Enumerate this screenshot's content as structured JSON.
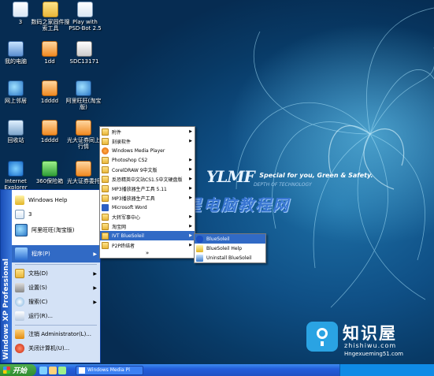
{
  "desktop_icons": [
    {
      "label": "3",
      "icon": "document-icon"
    },
    {
      "label": "数码之家固件搜索工具",
      "icon": "folder-icon"
    },
    {
      "label": "Play with PSD-Bot 2.5",
      "icon": "document-icon"
    },
    {
      "label": "我的电脑",
      "icon": "computer-icon"
    },
    {
      "label": "1dd",
      "icon": "app-icon"
    },
    {
      "label": "SDC13171",
      "icon": "video-icon"
    },
    {
      "label": "网上邻居",
      "icon": "network-icon"
    },
    {
      "label": "1dddd",
      "icon": "app-icon"
    },
    {
      "label": "阿里旺旺(淘宝版)",
      "icon": "network-icon"
    },
    {
      "label": "回收站",
      "icon": "recycle-bin-icon"
    },
    {
      "label": "1dddd",
      "icon": "app-icon"
    },
    {
      "label": "光大证券同上行情",
      "icon": "app-icon"
    },
    {
      "label": "Internet Explorer",
      "icon": "ie-icon"
    },
    {
      "label": "360保险箱",
      "icon": "safe-icon"
    },
    {
      "label": "光大证券委托",
      "icon": "app-icon"
    }
  ],
  "wallpaper": {
    "brand": "YLMF",
    "tagline": "Special for you, Green & Safety.",
    "subtitle": "DEPTH OF TECHNOLOGY"
  },
  "watermark": "星星电脑教程网",
  "start_menu": {
    "band_text": "Windows XP Professional",
    "pinned": [
      {
        "label": "Windows Help"
      },
      {
        "label": "3"
      },
      {
        "label": "阿里旺旺(淘宝版)"
      }
    ],
    "items": [
      {
        "label": "程序(P)"
      },
      {
        "label": "文档(D)"
      },
      {
        "label": "设置(S)"
      },
      {
        "label": "搜索(C)"
      },
      {
        "label": "运行(R)..."
      }
    ],
    "logoff": "注销 Administrator(L)...",
    "shutdown": "关闭计算机(U)..."
  },
  "programs_menu": {
    "items": [
      {
        "label": "附件"
      },
      {
        "label": "刻录软件"
      },
      {
        "label": "Windows Media Player"
      },
      {
        "label": "Photoshop CS2"
      },
      {
        "label": "CorelDRAW 9中文版"
      },
      {
        "label": "反恐精英中文站CS1.5中文硬盘版"
      },
      {
        "label": "MP3播放器生产工具 5.11"
      },
      {
        "label": "MP3播放器生产工具"
      },
      {
        "label": "Microsoft Word"
      },
      {
        "label": "大转军事中心"
      },
      {
        "label": "淘宝网"
      },
      {
        "label": "IVT BlueSoleil"
      },
      {
        "label": "P2P终结者"
      }
    ],
    "more": "»"
  },
  "bluesoleil_menu": {
    "items": [
      {
        "label": "BlueSoleil"
      },
      {
        "label": "BlueSoleil Help"
      },
      {
        "label": "Uninstall BlueSoleil"
      }
    ]
  },
  "taskbar": {
    "start_label": "开始",
    "task_label": "Windows Media Pl"
  },
  "site_logo": {
    "name": "知识屋",
    "domain": "zhishiwu.com",
    "url": "Hngexueming51.com"
  }
}
